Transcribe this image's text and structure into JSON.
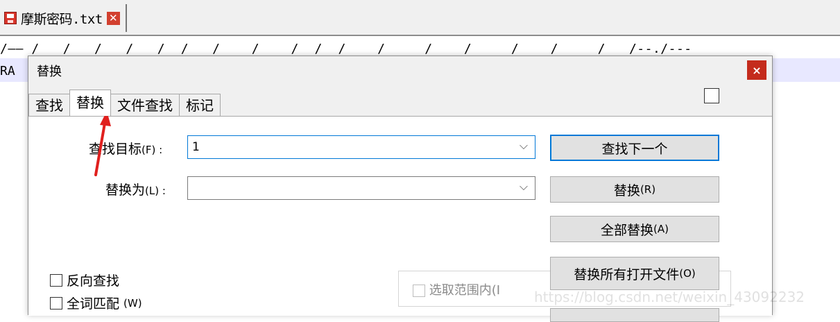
{
  "file_tab": {
    "name": "摩斯密码.txt",
    "close_icon": "close-icon",
    "save_icon": "floppy-icon"
  },
  "editor": {
    "line1": "/—— /   /   /   /   /  /   /    /    /  /  /    /     /    /     /    /     /   /--./---",
    "line2": "RA"
  },
  "dialog": {
    "title": "替换",
    "close": "×",
    "tabs": [
      "查找",
      "替换",
      "文件查找",
      "标记"
    ],
    "active_tab": "替换",
    "find_label_main": "查找目标",
    "find_label_key": "(F) :",
    "find_value": "1",
    "replace_label_main": "替换为",
    "replace_label_key": "(L) :",
    "replace_value": "",
    "btn_find_next": "查找下一个",
    "btn_replace_main": "替换",
    "btn_replace_key": "(R)",
    "btn_replace_all_main": "全部替换",
    "btn_replace_all_key": "(A)",
    "btn_replace_all_open_main": "替换所有打开文件",
    "btn_replace_all_open_key": "(O)",
    "in_selection": "选取范围内(I",
    "opt_reverse": "反向查找",
    "opt_wholeword_main": "全词匹配",
    "opt_wholeword_key": "(W)"
  },
  "watermark": "https://blog.csdn.net/weixin_43092232",
  "colors": {
    "accent": "#0078d7",
    "close_red": "#c42b1c",
    "arrow": "#e0201e"
  }
}
